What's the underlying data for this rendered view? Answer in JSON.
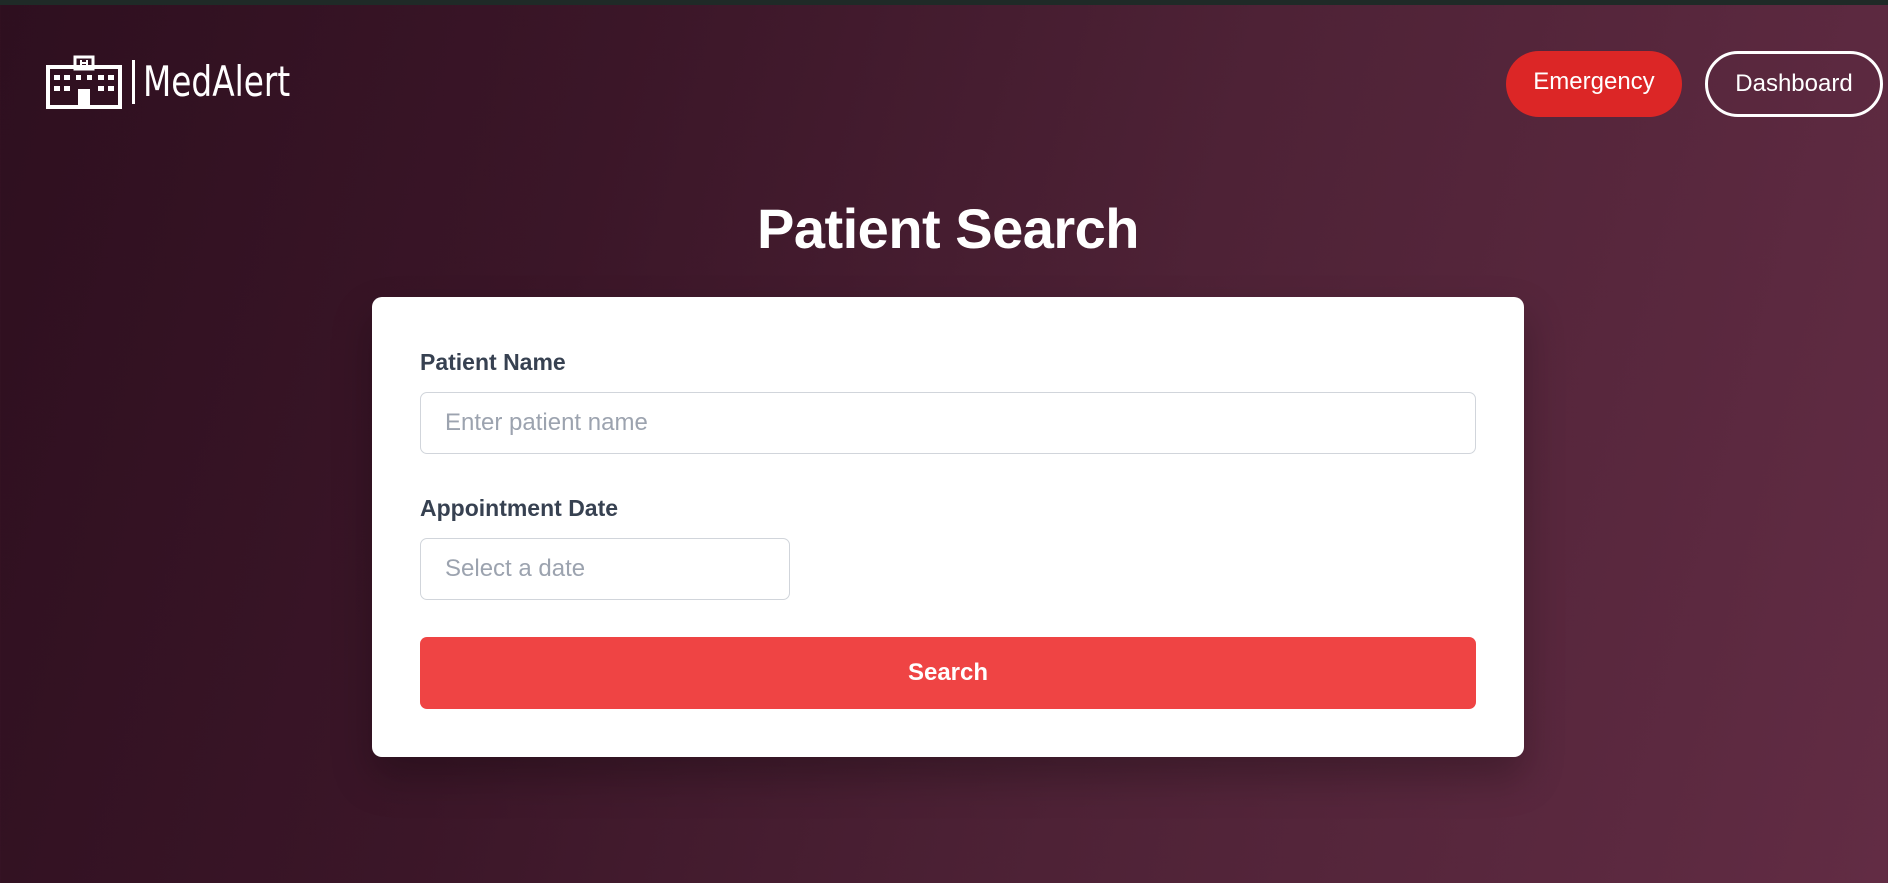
{
  "header": {
    "logo_icon": "hospital-icon",
    "logo_text": "MedAlert",
    "emergency_label": "Emergency",
    "dashboard_label": "Dashboard"
  },
  "main": {
    "title": "Patient Search",
    "form": {
      "patient_name_label": "Patient Name",
      "patient_name_placeholder": "Enter patient name",
      "patient_name_value": "",
      "appointment_date_label": "Appointment Date",
      "appointment_date_placeholder": "Select a date",
      "appointment_date_value": "",
      "search_label": "Search"
    }
  },
  "colors": {
    "background_start": "#2e0f1f",
    "background_end": "#622c44",
    "emergency": "#dc2626",
    "search_button": "#ef4444",
    "label_text": "#374151",
    "placeholder_text": "#9ca3af"
  }
}
